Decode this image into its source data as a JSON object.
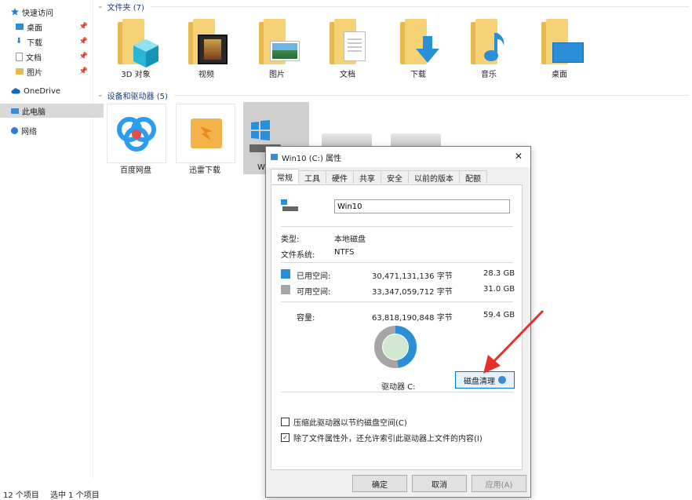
{
  "sidebar": {
    "quick_access": "快速访问",
    "items": [
      {
        "label": "桌面"
      },
      {
        "label": "下载"
      },
      {
        "label": "文档"
      },
      {
        "label": "图片"
      }
    ],
    "onedrive": "OneDrive",
    "this_pc": "此电脑",
    "network": "网络"
  },
  "folders_group": {
    "header": "文件夹 (7)",
    "items": [
      {
        "label": "3D 对象",
        "icon": "cube-icon"
      },
      {
        "label": "视频",
        "icon": "film-icon"
      },
      {
        "label": "图片",
        "icon": "picture-icon"
      },
      {
        "label": "文档",
        "icon": "document-icon"
      },
      {
        "label": "下载",
        "icon": "download-arrow-icon"
      },
      {
        "label": "音乐",
        "icon": "music-note-icon"
      },
      {
        "label": "桌面",
        "icon": "desktop-icon"
      }
    ]
  },
  "drives_group": {
    "header": "设备和驱动器 (5)",
    "items": [
      {
        "label": "百度网盘"
      },
      {
        "label": "迅雷下载"
      },
      {
        "label": "W"
      }
    ]
  },
  "status_bar": {
    "count": "12 个项目",
    "selected": "选中 1 个项目"
  },
  "dialog": {
    "title": "Win10 (C:) 属性",
    "close": "✕",
    "tabs": [
      "常规",
      "工具",
      "硬件",
      "共享",
      "安全",
      "以前的版本",
      "配额"
    ],
    "drive_name": "Win10",
    "type_label": "类型:",
    "type_value": "本地磁盘",
    "fs_label": "文件系统:",
    "fs_value": "NTFS",
    "used_label": "已用空间:",
    "used_bytes": "30,471,131,136 字节",
    "used_gb": "28.3 GB",
    "free_label": "可用空间:",
    "free_bytes": "33,347,059,712 字节",
    "free_gb": "31.0 GB",
    "cap_label": "容量:",
    "cap_bytes": "63,818,190,848 字节",
    "cap_gb": "59.4 GB",
    "used_fraction": 0.4775,
    "used_color": "#2b8fd8",
    "free_color": "#a6a6a6",
    "drive_label": "驱动器 C:",
    "cleanup_button": "磁盘清理",
    "compress_label": "压缩此驱动器以节约磁盘空间(C)",
    "compress_checked": false,
    "index_label": "除了文件属性外，还允许索引此驱动器上文件的内容(I)",
    "index_checked": true,
    "ok": "确定",
    "cancel": "取消",
    "apply": "应用(A)"
  }
}
